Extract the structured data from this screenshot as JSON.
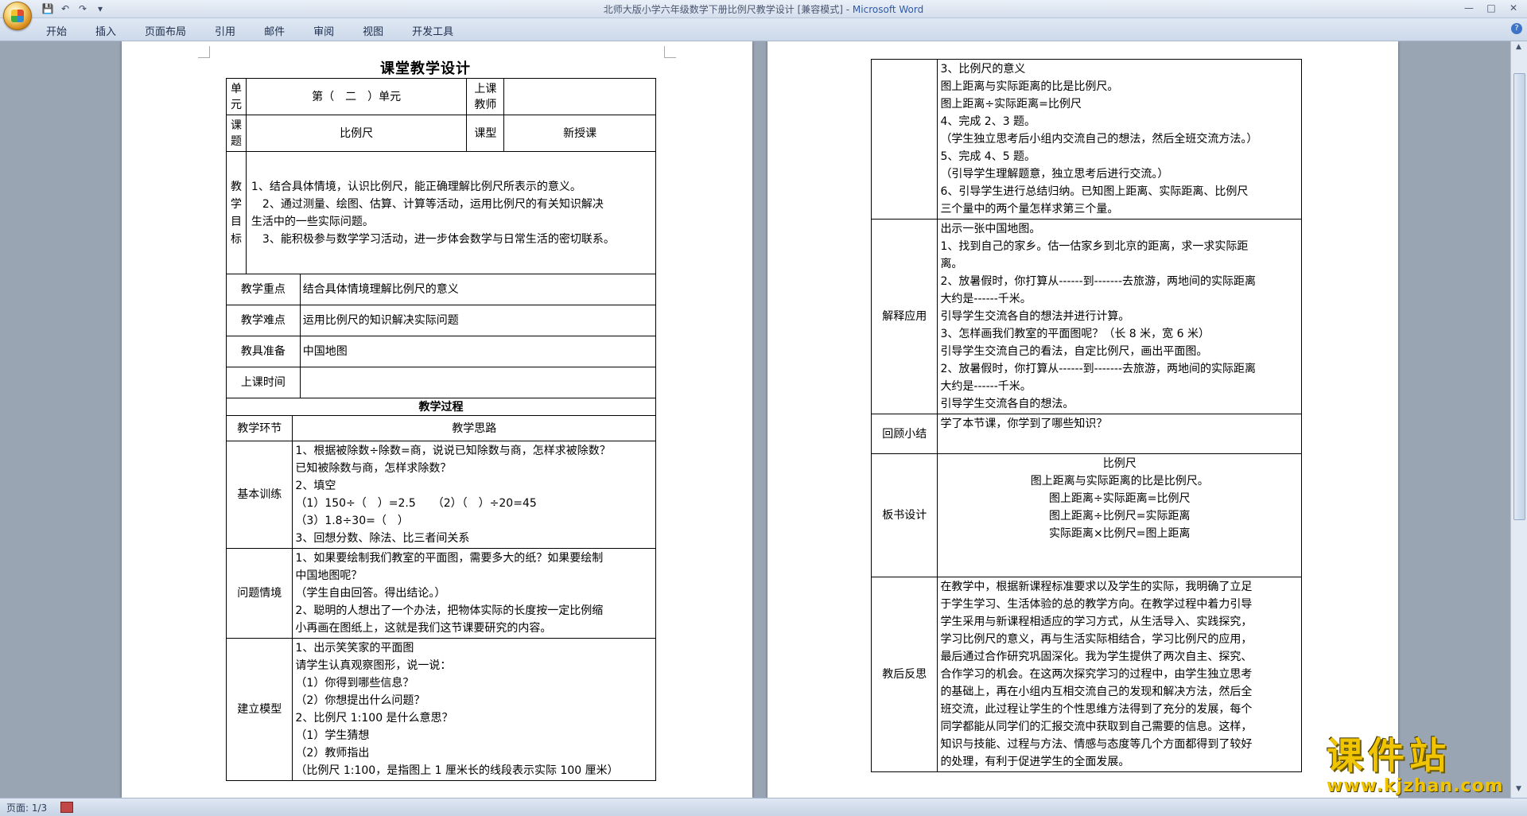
{
  "window": {
    "title_doc": "北师大版小学六年级数学下册比例尺教学设计 [兼容模式] - ",
    "title_app": "Microsoft Word"
  },
  "ribbon": {
    "tabs": [
      "开始",
      "插入",
      "页面布局",
      "引用",
      "邮件",
      "审阅",
      "视图",
      "开发工具"
    ]
  },
  "status": {
    "page": "页面: 1/3"
  },
  "logo": {
    "text": "课件站",
    "url": "www.kjzhan.com"
  },
  "doc": {
    "title": "课堂教学设计",
    "unit_label": "单元",
    "unit_value": "第（　二　）单元",
    "teacher_label": "上课教师",
    "topic_label": "课题",
    "topic_value": "比例尺",
    "type_label": "课型",
    "type_value": "新授课",
    "goal_label": "教学目标",
    "goals": [
      "1、结合具体情境，认识比例尺，能正确理解比例尺所表示的意义。",
      "　2、通过测量、绘图、估算、计算等活动，运用比例尺的有关知识解决",
      "生活中的一些实际问题。",
      "　3、能积极参与数学学习活动，进一步体会数学与日常生活的密切联系。"
    ],
    "key_label": "教学重点",
    "key_value": "结合具体情境理解比例尺的意义",
    "diff_label": "教学难点",
    "diff_value": "运用比例尺的知识解决实际问题",
    "prep_label": "教具准备",
    "prep_value": "中国地图",
    "time_label": "上课时间",
    "process_title": "教学过程",
    "col_stage": "教学环节",
    "col_idea": "教学思路",
    "sections1": [
      {
        "label": "基本训练",
        "lines": [
          "1、根据被除数÷除数=商，说说已知除数与商，怎样求被除数？",
          "已知被除数与商，怎样求除数？",
          "2、填空",
          "（1）150÷（　）=2.5　　（2）（　）÷20=45",
          "（3）1.8÷30=（　）",
          "3、回想分数、除法、比三者间关系"
        ]
      },
      {
        "label": "问题情境",
        "lines": [
          "1、如果要绘制我们教室的平面图，需要多大的纸？如果要绘制",
          "中国地图呢？",
          "（学生自由回答。得出结论。）",
          "2、聪明的人想出了一个办法，把物体实际的长度按一定比例缩",
          "小再画在图纸上，这就是我们这节课要研究的内容。"
        ]
      },
      {
        "label": "建立模型",
        "lines": [
          "1、出示笑笑家的平面图",
          "请学生认真观察图形，说一说：",
          "（1）你得到哪些信息？",
          "（2）你想提出什么问题？",
          "2、比例尺 1:100 是什么意思？",
          "（1）学生猜想",
          "（2）教师指出",
          "（比例尺 1:100，是指图上 1 厘米长的线段表示实际 100 厘米）"
        ]
      }
    ],
    "page2_top_lines": [
      "3、比例尺的意义",
      "图上距离与实际距离的比是比例尺。",
      "图上距离÷实际距离=比例尺",
      "4、完成 2、3 题。",
      "（学生独立思考后小组内交流自己的想法，然后全班交流方法。）",
      "5、完成 4、5 题。",
      "（引导学生理解题意，独立思考后进行交流。）",
      "6、引导学生进行总结归纳。已知图上距离、实际距离、比例尺",
      "三个量中的两个量怎样求第三个量。"
    ],
    "sections2": [
      {
        "label": "解释应用",
        "lines": [
          "出示一张中国地图。",
          "1、找到自己的家乡。估一估家乡到北京的距离，求一求实际距",
          "离。",
          "2、放暑假时，你打算从------到-------去旅游，两地间的实际距离",
          "大约是------千米。",
          "引导学生交流各自的想法并进行计算。",
          "3、怎样画我们教室的平面图呢？（长 8 米，宽 6 米）",
          "引导学生交流自己的看法，自定比例尺，画出平面图。",
          "2、放暑假时，你打算从------到-------去旅游，两地间的实际距离",
          "大约是------千米。",
          "引导学生交流各自的想法。"
        ]
      },
      {
        "label": "回顾小结",
        "lines": [
          "学了本节课，你学到了哪些知识？"
        ]
      },
      {
        "label": "板书设计",
        "lines": [
          "比例尺",
          "图上距离与实际距离的比是比例尺。",
          "图上距离÷实际距离=比例尺",
          "图上距离÷比例尺=实际距离",
          "实际距离×比例尺=图上距离"
        ]
      },
      {
        "label": "教后反思",
        "lines": [
          "在教学中，根据新课程标准要求以及学生的实际，我明确了立足",
          "于学生学习、生活体验的总的教学方向。在教学过程中着力引导",
          "学生采用与新课程相适应的学习方式，从生活导入、实践探究，",
          "学习比例尺的意义，再与生活实际相结合，学习比例尺的应用，",
          "最后通过合作研究巩固深化。我为学生提供了两次自主、探究、",
          "合作学习的机会。在这两次探究学习的过程中，由学生独立思考",
          "的基础上，再在小组内互相交流自己的发现和解决方法，然后全",
          "班交流，此过程让学生的个性思维方法得到了充分的发展，每个",
          "同学都能从同学们的汇报交流中获取到自己需要的信息。这样，",
          "知识与技能、过程与方法、情感与态度等几个方面都得到了较好",
          "的处理，有利于促进学生的全面发展。"
        ]
      }
    ]
  }
}
